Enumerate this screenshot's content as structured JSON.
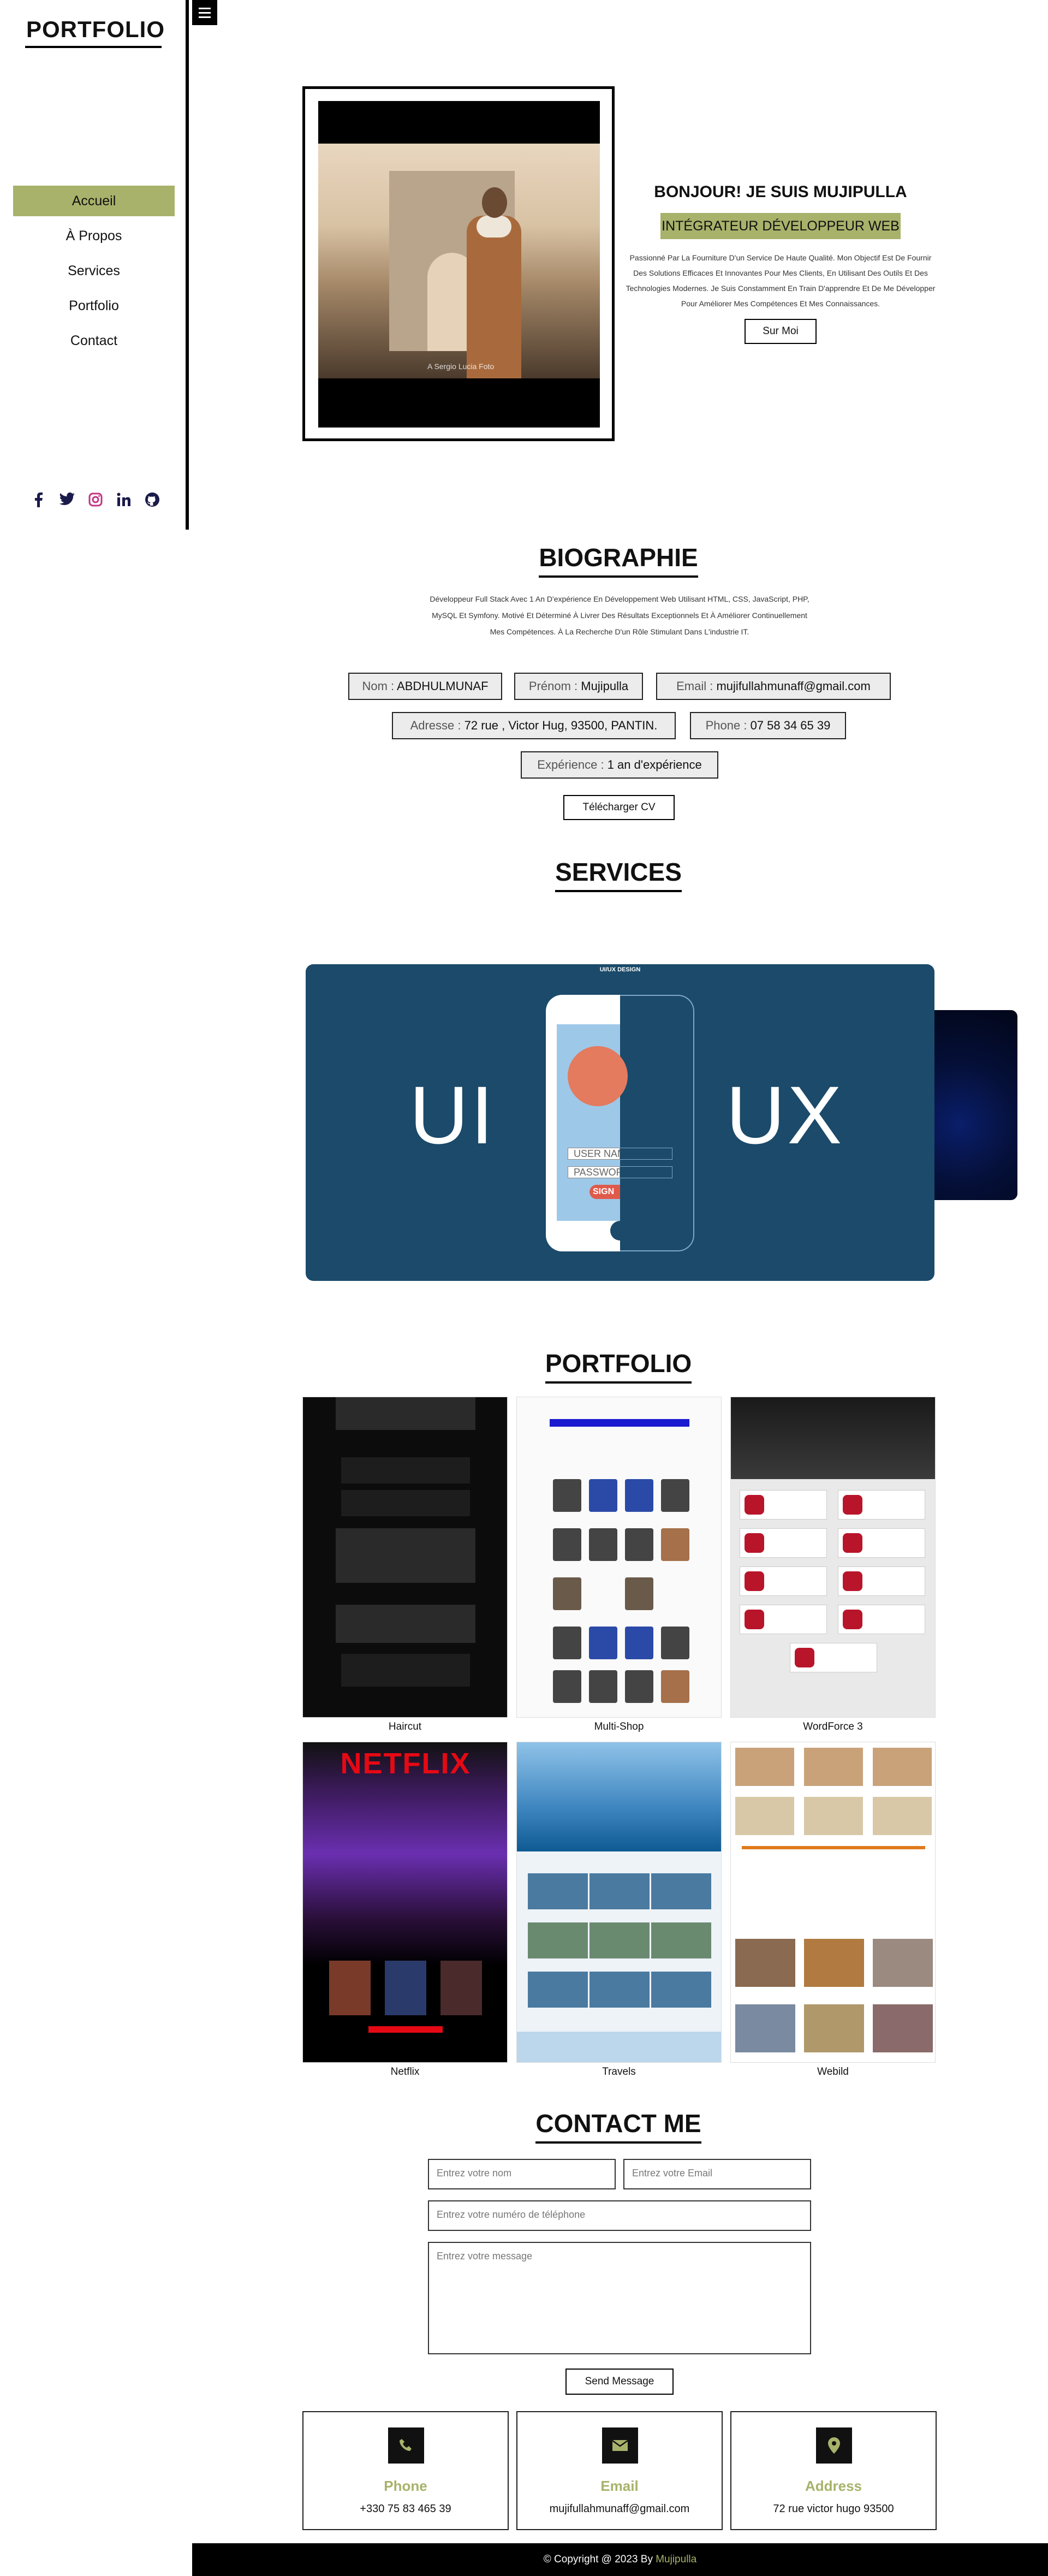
{
  "sidebar": {
    "brand": "PORTFOLIO",
    "nav": [
      {
        "label": "Accueil",
        "active": true
      },
      {
        "label": "À Propos",
        "active": false
      },
      {
        "label": "Services",
        "active": false
      },
      {
        "label": "Portfolio",
        "active": false
      },
      {
        "label": "Contact",
        "active": false
      }
    ],
    "socials": [
      "facebook-icon",
      "twitter-icon",
      "instagram-icon",
      "linkedin-icon",
      "github-icon"
    ],
    "active_color": "#a8b26a"
  },
  "hero": {
    "greeting": "BONJOUR! JE SUIS MUJIPULLA",
    "role": "INTÉGRATEUR DÉVELOPPEUR WEB",
    "intro": "Passionné Par La Fourniture D'un Service De Haute Qualité. Mon Objectif Est De Fournir Des Solutions Efficaces Et Innovantes Pour Mes Clients, En Utilisant Des Outils Et Des Technologies Modernes. Je Suis Constamment En Train D'apprendre Et De Me Développer Pour Améliorer Mes Compétences Et Mes Connaissances.",
    "button": "Sur Moi",
    "photo_caption": "A Sergio Lucia Foto"
  },
  "biography": {
    "title": "BIOGRAPHIE",
    "text": "Développeur Full Stack Avec 1 An D'expérience En Développement Web Utilisant HTML, CSS, JavaScript, PHP, MySQL Et Symfony. Motivé Et Déterminé À Livrer Des Résultats Exceptionnels Et À Améliorer Continuellement Mes Compétences. À La Recherche D'un Rôle Stimulant Dans L'industrie IT.",
    "nom_label": "Nom : ",
    "nom": "ABDHULMUNAF",
    "prenom_label": "Prénom : ",
    "prenom": "Mujipulla",
    "email_label": "Email : ",
    "email": "mujifullahmunaff@gmail.com",
    "adresse_label": "Adresse : ",
    "adresse": "72 rue , Victor Hug, 93500, PANTIN.",
    "phone_label": "Phone : ",
    "phone": "07 58 34 65 39",
    "exp_label": "Expérience : ",
    "exp": "1 an d'expérience",
    "cv_button": "Télécharger CV"
  },
  "services": {
    "title": "SERVICES",
    "slide_title": "UI/UX DESIGN",
    "left_word": "UI",
    "right_word": "UX",
    "field1": "USER NAME",
    "field2": "PASSWORD",
    "signin": "SIGN"
  },
  "portfolio": {
    "title": "PORTFOLIO",
    "items": [
      {
        "label": "Haircut"
      },
      {
        "label": "Multi-Shop"
      },
      {
        "label": "WordForce 3"
      },
      {
        "label": "Netflix",
        "logo": "NETFLIX"
      },
      {
        "label": "Travels"
      },
      {
        "label": "Webild"
      }
    ]
  },
  "contact": {
    "title": "CONTACT ME",
    "name_placeholder": "Entrez votre nom",
    "email_placeholder": "Entrez votre Email",
    "phone_placeholder": "Entrez votre numéro de téléphone",
    "message_placeholder": "Entrez votre message",
    "send_button": "Send Message",
    "cards": [
      {
        "icon": "phone-icon",
        "title": "Phone",
        "value": "+330 75 83 465 39"
      },
      {
        "icon": "envelope-icon",
        "title": "Email",
        "value": "mujifullahmunaff@gmail.com"
      },
      {
        "icon": "map-pin-icon",
        "title": "Address",
        "value": "72 rue victor hugo 93500"
      }
    ]
  },
  "footer": {
    "prefix": "© Copyright @ 2023 By ",
    "name": "Mujipulla"
  }
}
